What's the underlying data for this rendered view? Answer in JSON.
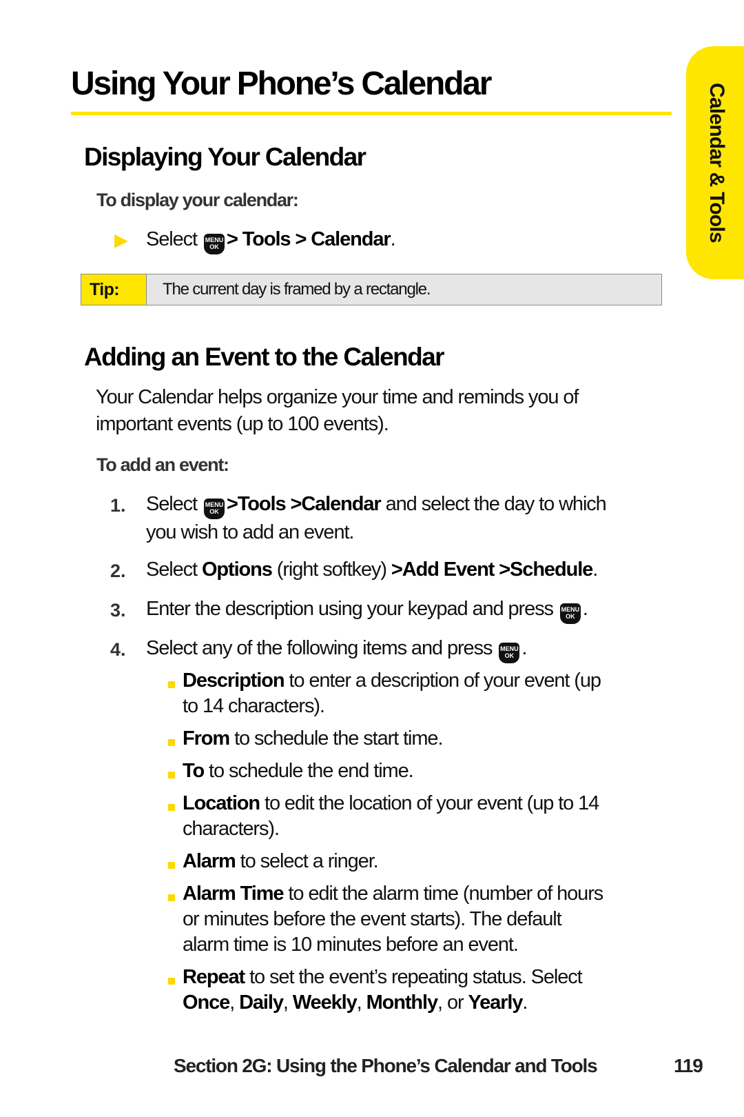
{
  "page": {
    "title": "Using Your Phone’s Calendar",
    "side_tab": "Calendar & Tools"
  },
  "section1": {
    "heading": "Displaying Your Calendar",
    "procedure_heading": "To display your calendar:",
    "step": {
      "prefix": "Select",
      "key_icon": "menu-ok-key",
      "key_top": "MENU",
      "key_bottom": "OK",
      "path": [
        "Tools",
        "Calendar"
      ],
      "separator": ">",
      "suffix": "."
    },
    "tip": {
      "label": "Tip:",
      "text": "The current day is framed by a rectangle."
    }
  },
  "section2": {
    "heading": "Adding an Event to the Calendar",
    "intro_line1": "Your Calendar helps organize your time and reminds you of",
    "intro_line2": "important events (up to 100 events).",
    "procedure_heading": "To add an event:",
    "steps": [
      {
        "number": "1.",
        "prefix": "Select",
        "bold1": "Tools",
        "bold2": "Calendar",
        "rest": " and select the day to which",
        "line2": "you wish to add an event."
      },
      {
        "number": "2.",
        "prefix": "Select ",
        "bold1": "Options",
        "middle": " (right softkey) ",
        "bold2": "Add Event",
        "bold3": "Schedule",
        "suffix": "."
      },
      {
        "number": "3.",
        "text": "Enter the description using your keypad and press",
        "suffix": "."
      },
      {
        "number": "4.",
        "text": "Select any of the following items and press",
        "suffix": "."
      }
    ],
    "options": [
      {
        "term": "Description",
        "text": " to enter a description of your event (up",
        "line2": "to 14 characters)."
      },
      {
        "term": "From",
        "text": " to schedule the start time."
      },
      {
        "term": "To",
        "text": " to schedule the end time."
      },
      {
        "term": "Location",
        "text": " to edit the location of your event (up to 14",
        "line2": "characters)."
      },
      {
        "term": "Alarm",
        "text": " to select a ringer."
      },
      {
        "term": "Alarm Time",
        "text": " to edit the alarm time (number of hours",
        "line2": "or minutes before the event starts). The default",
        "line3": "alarm time is 10 minutes before an event."
      },
      {
        "term": "Repeat",
        "text": " to set the event’s repeating status. Select",
        "choices": [
          "Once",
          "Daily",
          "Weekly",
          "Monthly"
        ],
        "or_word": "or",
        "last_choice": "Yearly",
        "suffix": "."
      }
    ]
  },
  "footer": {
    "section_label": "Section 2G: Using the Phone’s Calendar and Tools",
    "page_number": "119"
  },
  "colors": {
    "accent_yellow": "#ffe600",
    "tip_background": "#e6e6e6"
  }
}
